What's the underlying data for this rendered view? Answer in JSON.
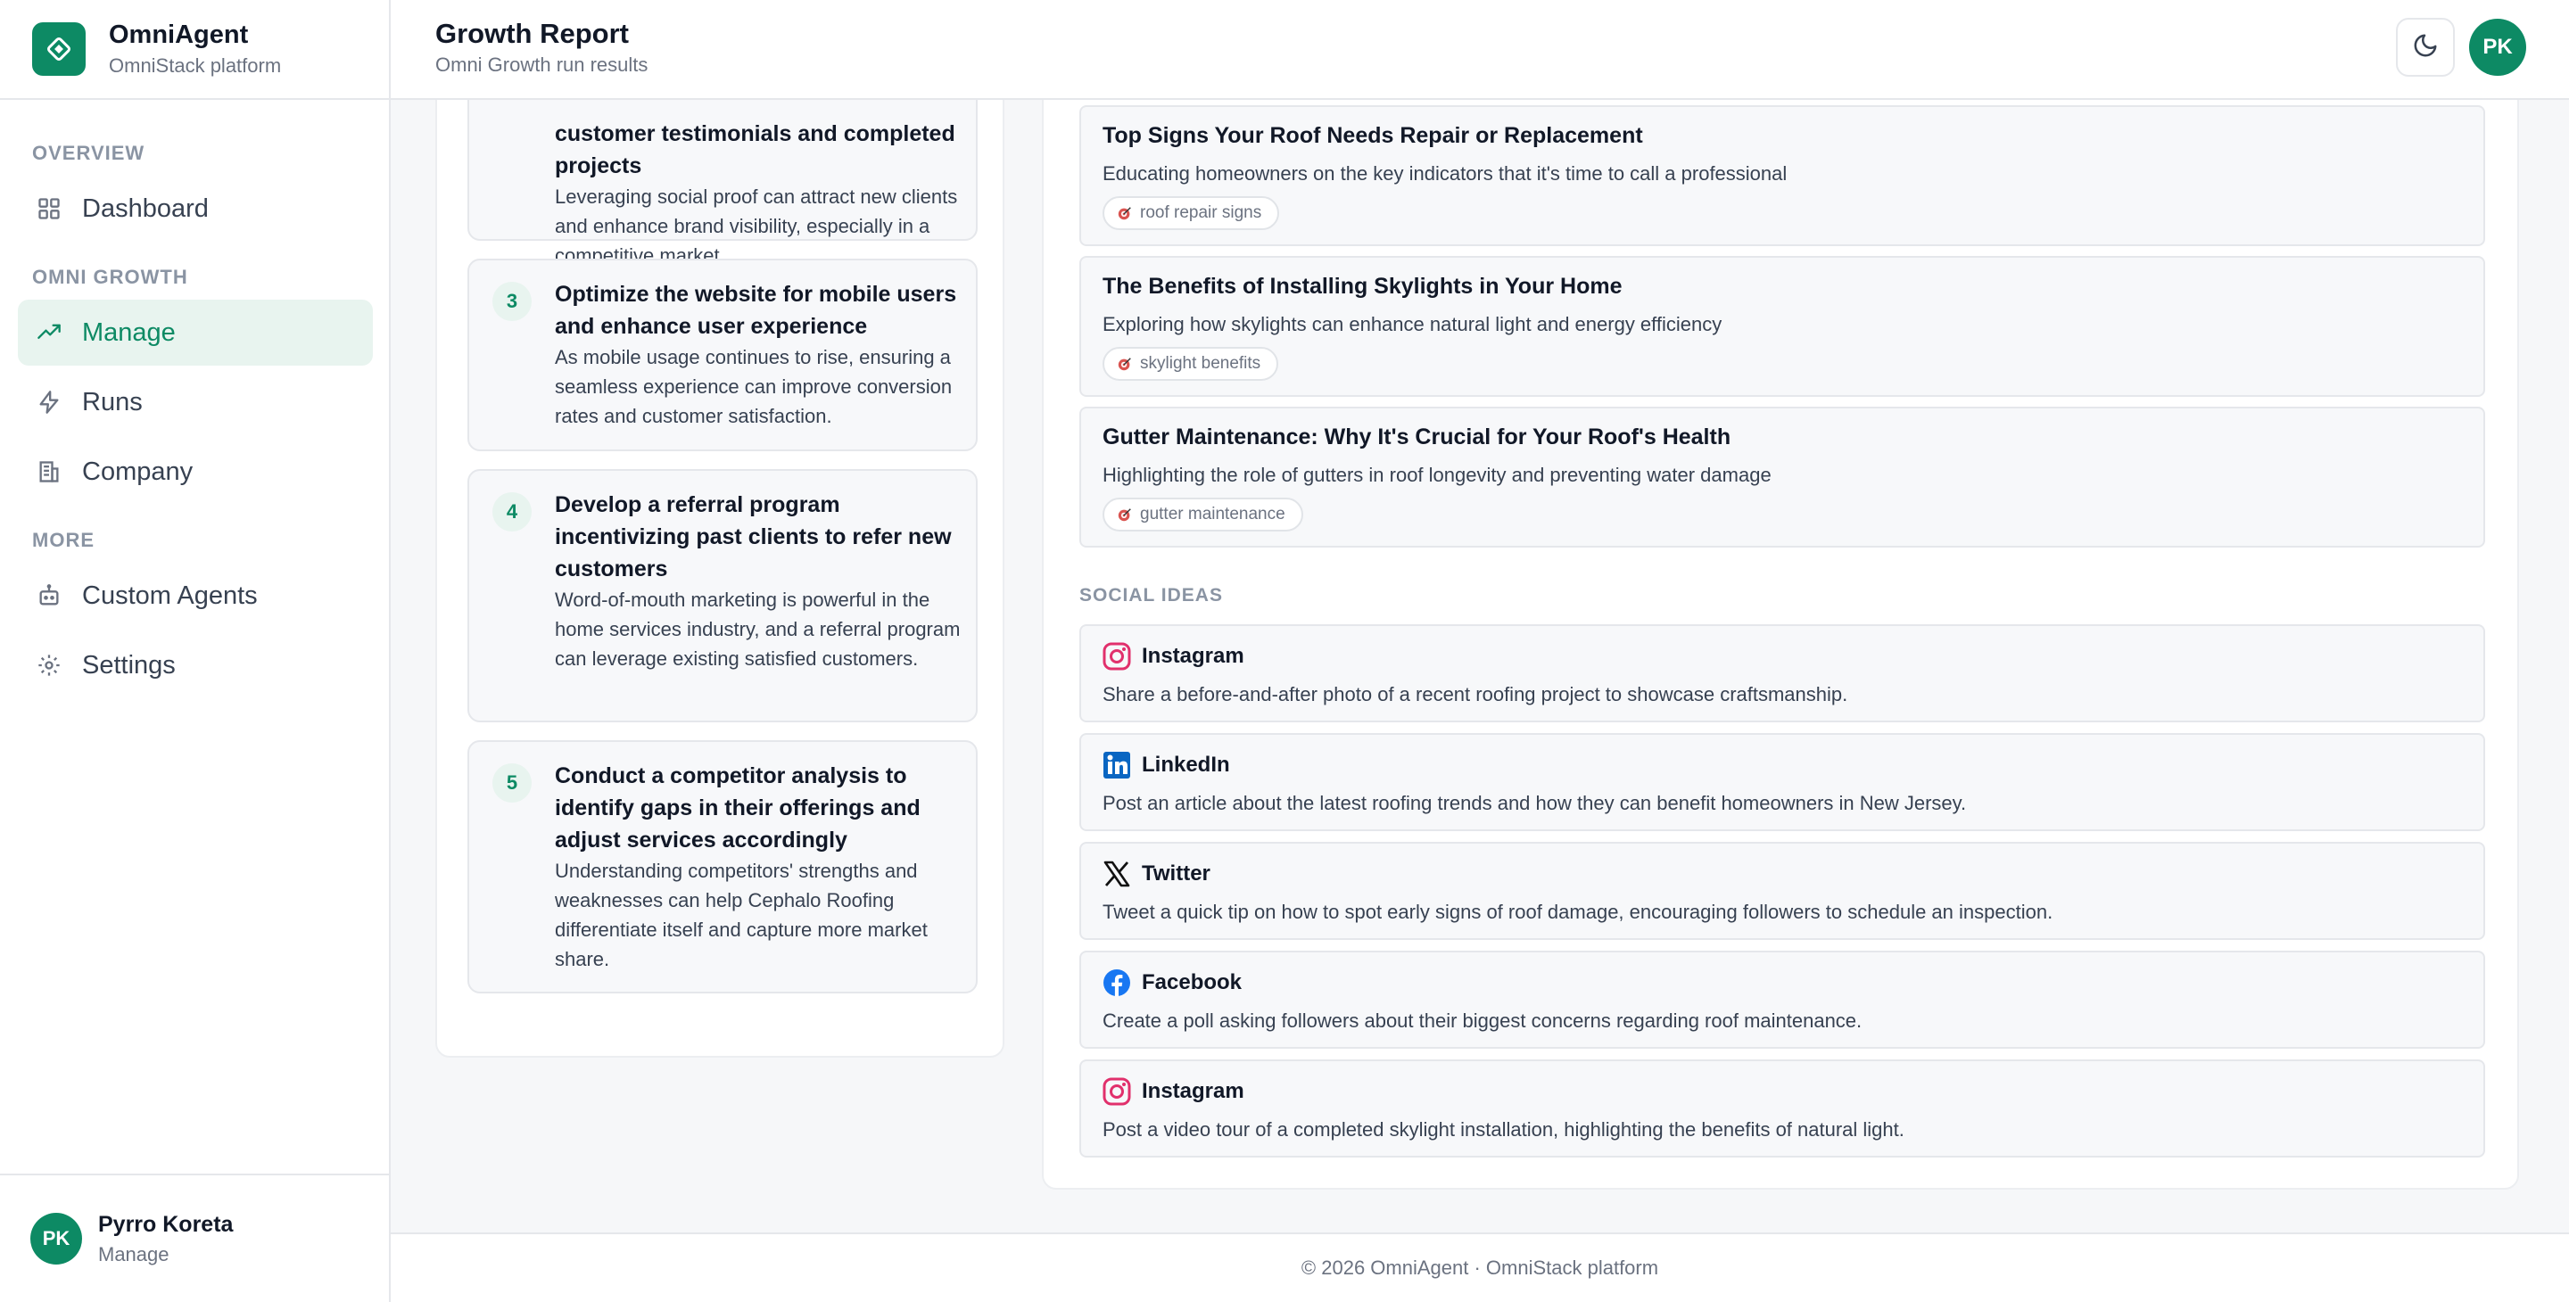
{
  "app": {
    "name": "OmniAgent",
    "subtitle": "OmniStack platform",
    "accent_color": "#0d8a64"
  },
  "sidebar": {
    "sections": {
      "overview": "OVERVIEW",
      "omni_growth": "OMNI GROWTH",
      "more": "MORE"
    },
    "items": [
      {
        "label": "Dashboard",
        "icon": "grid-icon",
        "active": false
      },
      {
        "label": "Manage",
        "icon": "trending-up-icon",
        "active": true
      },
      {
        "label": "Runs",
        "icon": "lightning-icon",
        "active": false
      },
      {
        "label": "Company",
        "icon": "building-icon",
        "active": false
      },
      {
        "label": "Custom Agents",
        "icon": "bot-icon",
        "active": false
      },
      {
        "label": "Settings",
        "icon": "gear-icon",
        "active": false
      }
    ],
    "user": {
      "initials": "PK",
      "name": "Pyrro Koreta",
      "role": "Manage"
    }
  },
  "header": {
    "title": "Growth Report",
    "subtitle": "Omni Growth run results",
    "avatar_initials": "PK",
    "theme_icon": "moon-icon"
  },
  "recommendations": [
    {
      "number": "",
      "title": "customer testimonials and completed projects",
      "description": "Leveraging social proof can attract new clients and enhance brand visibility, especially in a competitive market."
    },
    {
      "number": "3",
      "title": "Optimize the website for mobile users and enhance user experience",
      "description": "As mobile usage continues to rise, ensuring a seamless experience can improve conversion rates and customer satisfaction."
    },
    {
      "number": "4",
      "title": "Develop a referral program incentivizing past clients to refer new customers",
      "description": "Word-of-mouth marketing is powerful in the home services industry, and a referral program can leverage existing satisfied customers."
    },
    {
      "number": "5",
      "title": "Conduct a competitor analysis to identify gaps in their offerings and adjust services accordingly",
      "description": "Understanding competitors' strengths and weaknesses can help Cephalo Roofing differentiate itself and capture more market share."
    }
  ],
  "blog_ideas": [
    {
      "title": "Top Signs Your Roof Needs Repair or Replacement",
      "description": "Educating homeowners on the key indicators that it's time to call a professional",
      "keyword": "roof repair signs"
    },
    {
      "title": "The Benefits of Installing Skylights in Your Home",
      "description": "Exploring how skylights can enhance natural light and energy efficiency",
      "keyword": "skylight benefits"
    },
    {
      "title": "Gutter Maintenance: Why It's Crucial for Your Roof's Health",
      "description": "Highlighting the role of gutters in roof longevity and preventing water damage",
      "keyword": "gutter maintenance"
    }
  ],
  "social": {
    "label": "SOCIAL IDEAS",
    "ideas": [
      {
        "platform": "Instagram",
        "icon": "instagram-icon",
        "text": "Share a before-and-after photo of a recent roofing project to showcase craftsmanship."
      },
      {
        "platform": "LinkedIn",
        "icon": "linkedin-icon",
        "text": "Post an article about the latest roofing trends and how they can benefit homeowners in New Jersey."
      },
      {
        "platform": "Twitter",
        "icon": "x-twitter-icon",
        "text": "Tweet a quick tip on how to spot early signs of roof damage, encouraging followers to schedule an inspection."
      },
      {
        "platform": "Facebook",
        "icon": "facebook-icon",
        "text": "Create a poll asking followers about their biggest concerns regarding roof maintenance."
      },
      {
        "platform": "Instagram",
        "icon": "instagram-icon",
        "text": "Post a video tour of a completed skylight installation, highlighting the benefits of natural light."
      }
    ]
  },
  "footer": {
    "text": "© 2026 OmniAgent · OmniStack platform"
  }
}
